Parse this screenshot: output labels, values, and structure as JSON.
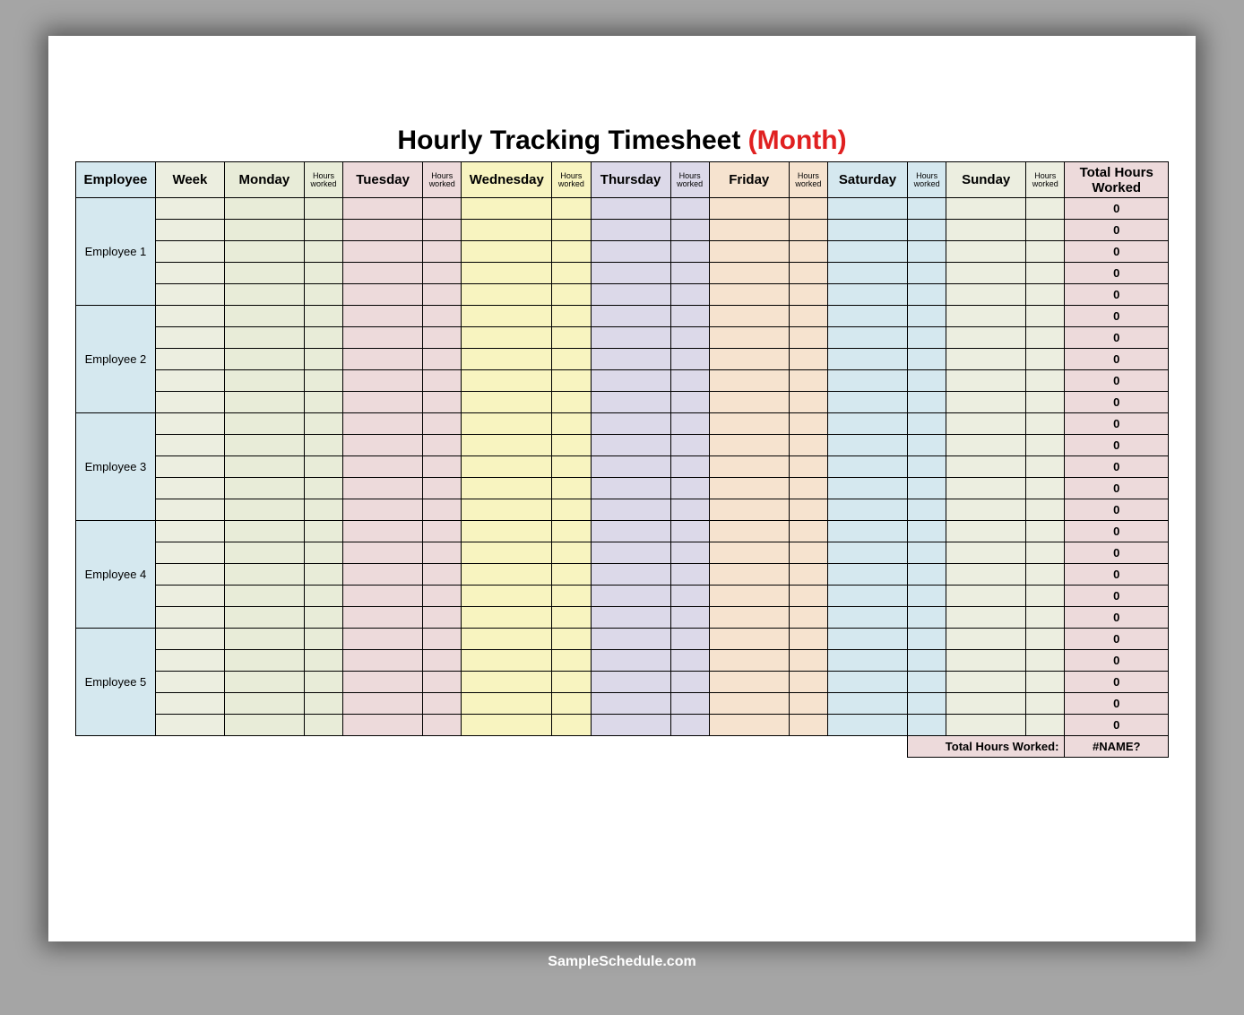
{
  "title": {
    "main": "Hourly Tracking Timesheet ",
    "month": "(Month)"
  },
  "headers": {
    "employee": "Employee",
    "week": "Week",
    "monday": "Monday",
    "tuesday": "Tuesday",
    "wednesday": "Wednesday",
    "thursday": "Thursday",
    "friday": "Friday",
    "saturday": "Saturday",
    "sunday": "Sunday",
    "hours_worked": "Hours worked",
    "total_hours_worked": "Total Hours Worked"
  },
  "employees": [
    {
      "name": "Employee 1",
      "weeks": 5
    },
    {
      "name": "Employee 2",
      "weeks": 5
    },
    {
      "name": "Employee 3",
      "weeks": 5
    },
    {
      "name": "Employee 4",
      "weeks": 5
    },
    {
      "name": "Employee 5",
      "weeks": 5
    }
  ],
  "row_total_value": "0",
  "footer": {
    "label": "Total Hours Worked:",
    "value": "#NAME?"
  },
  "watermark": "SampleSchedule.com"
}
